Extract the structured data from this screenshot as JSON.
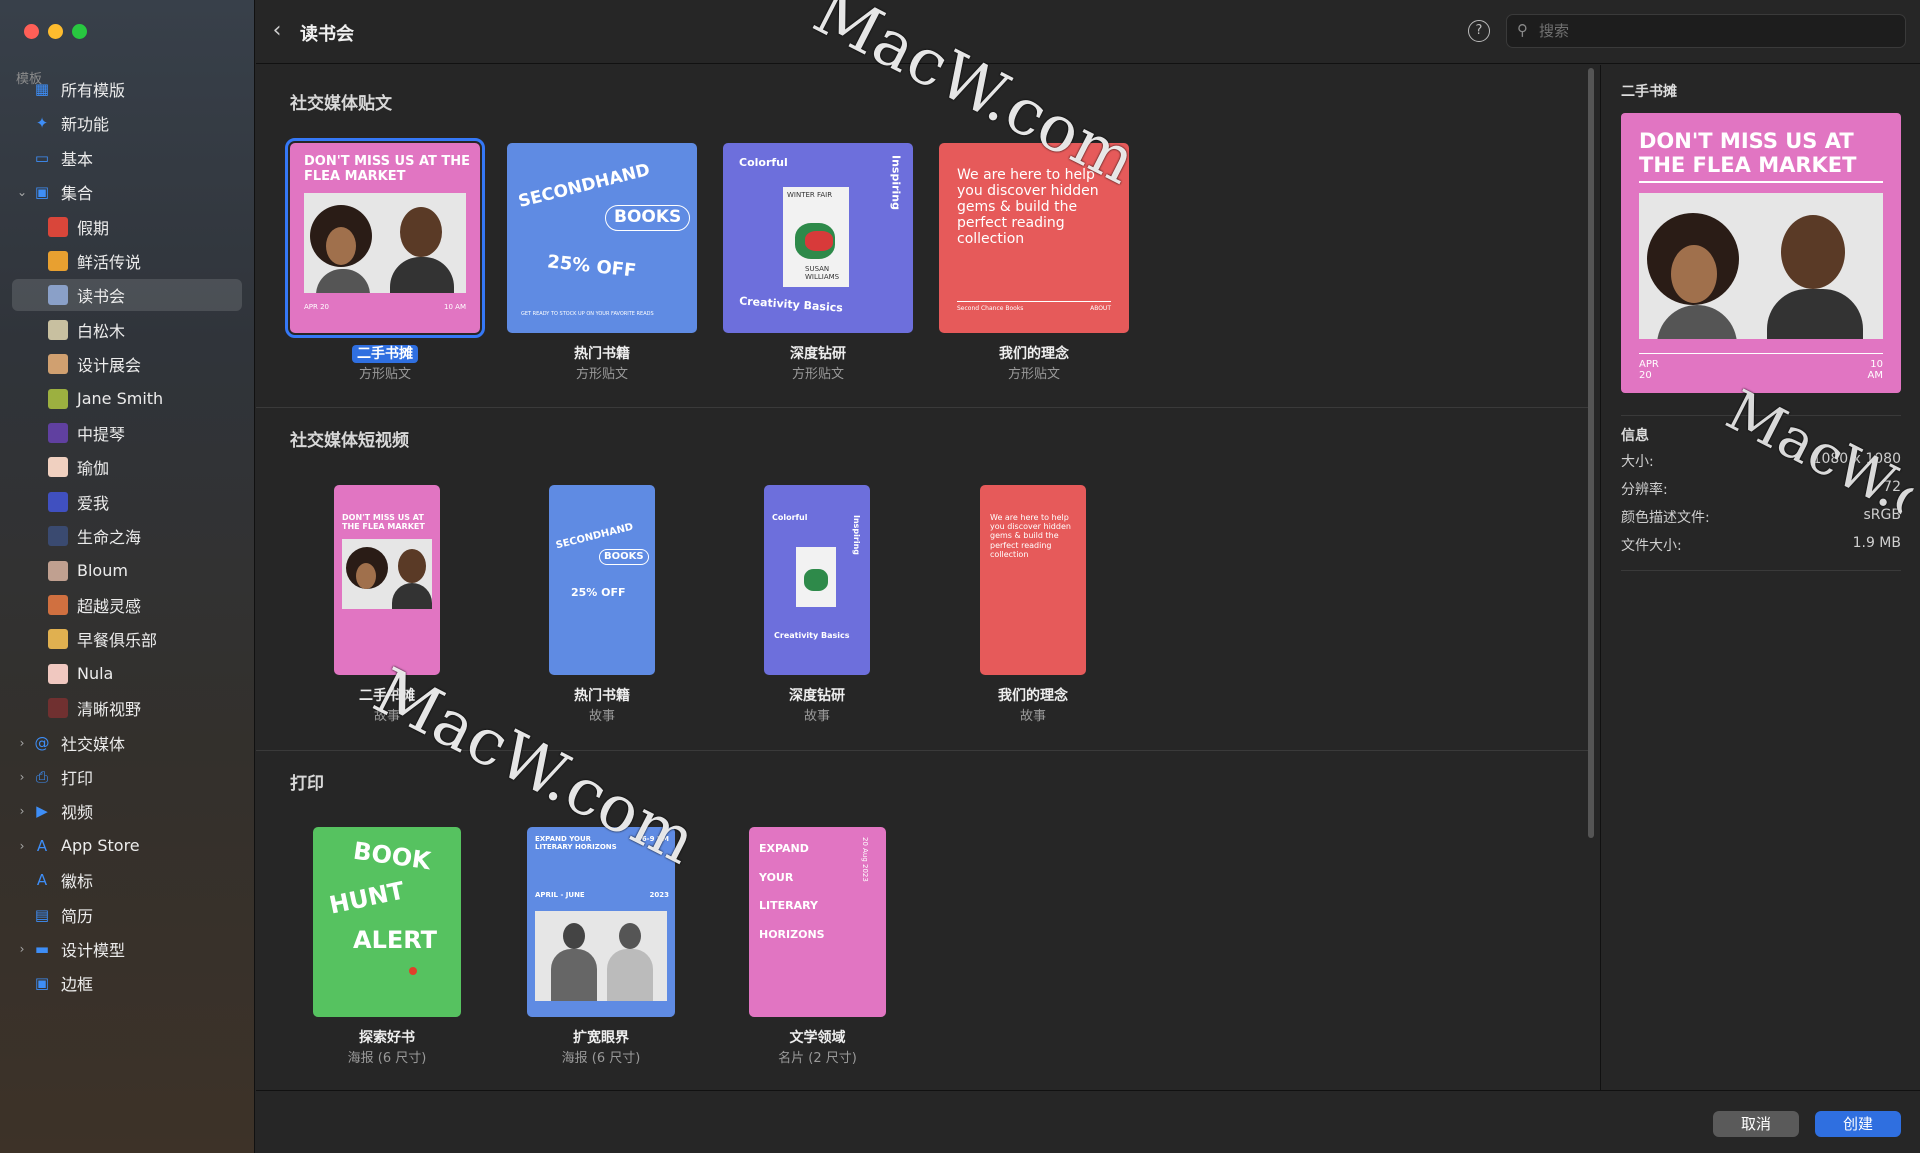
{
  "window": {
    "title": "读书会"
  },
  "sidebar": {
    "header": "模板",
    "items": [
      {
        "label": "所有模版",
        "icon": "grid-icon"
      },
      {
        "label": "新功能",
        "icon": "sparkle-icon"
      },
      {
        "label": "基本",
        "icon": "rectangle-icon"
      },
      {
        "label": "集合",
        "icon": "collection-icon"
      },
      {
        "label": "假期"
      },
      {
        "label": "鲜活传说"
      },
      {
        "label": "读书会"
      },
      {
        "label": "白松木"
      },
      {
        "label": "设计展会"
      },
      {
        "label": "Jane Smith"
      },
      {
        "label": "中提琴"
      },
      {
        "label": "瑜伽"
      },
      {
        "label": "爱我"
      },
      {
        "label": "生命之海"
      },
      {
        "label": "Bloum"
      },
      {
        "label": "超越灵感"
      },
      {
        "label": "早餐俱乐部"
      },
      {
        "label": "Nula"
      },
      {
        "label": "清晰视野"
      },
      {
        "label": "社交媒体",
        "icon": "at-icon"
      },
      {
        "label": "打印",
        "icon": "printer-icon"
      },
      {
        "label": "视频",
        "icon": "video-icon"
      },
      {
        "label": "App Store",
        "icon": "appstore-icon"
      },
      {
        "label": "徽标",
        "icon": "letter-a-icon"
      },
      {
        "label": "简历",
        "icon": "document-icon"
      },
      {
        "label": "设计模型",
        "icon": "monitor-icon"
      },
      {
        "label": "边框",
        "icon": "frame-icon"
      }
    ]
  },
  "search": {
    "placeholder": "搜索"
  },
  "sections": [
    {
      "title": "社交媒体贴文",
      "cards": [
        {
          "name": "二手书摊",
          "type": "方形贴文",
          "art": {
            "title": "DON'T MISS US AT THE FLEA MARKET",
            "date": "APR 20",
            "time": "10 AM"
          }
        },
        {
          "name": "热门书籍",
          "type": "方形贴文",
          "art": {
            "line1": "SECONDHAND",
            "line2": "BOOKS",
            "line3": "25% OFF",
            "foot": "GET READY TO STOCK UP ON YOUR FAVORITE READS"
          }
        },
        {
          "name": "深度钻研",
          "type": "方形贴文",
          "art": {
            "top": "Colorful",
            "side": "Inspiring",
            "book": "WINTER FAIR",
            "author": "SUSAN WILLIAMS",
            "bottom": "Creativity Basics"
          }
        },
        {
          "name": "我们的理念",
          "type": "方形贴文",
          "art": {
            "text": "We are here to help you discover hidden gems & build the perfect reading collection",
            "left": "Second Chance Books",
            "right": "ABOUT"
          }
        }
      ]
    },
    {
      "title": "社交媒体短视频",
      "cards": [
        {
          "name": "二手书摊",
          "type": "故事"
        },
        {
          "name": "热门书籍",
          "type": "故事"
        },
        {
          "name": "深度钻研",
          "type": "故事"
        },
        {
          "name": "我们的理念",
          "type": "故事"
        }
      ]
    },
    {
      "title": "打印",
      "cards": [
        {
          "name": "探索好书",
          "type": "海报 (6 尺寸)",
          "art": {
            "l1": "BOOK",
            "l2": "HUNT",
            "l3": "ALERT"
          }
        },
        {
          "name": "扩宽眼界",
          "type": "海报 (6 尺寸)",
          "art": {
            "title": "EXPAND YOUR LITERARY HORIZONS",
            "time": "6-9 PM",
            "dates": "APRIL - JUNE",
            "year": "2023"
          }
        },
        {
          "name": "文学领域",
          "type": "名片 (2 尺寸)",
          "art": {
            "title": "EXPAND YOUR LITERARY HORIZONS",
            "side": "20 Aug 2023"
          }
        }
      ]
    }
  ],
  "info": {
    "name": "二手书摊",
    "header": "信息",
    "rows": [
      {
        "k": "大小:",
        "v": "1080 x 1080"
      },
      {
        "k": "分辨率:",
        "v": "72"
      },
      {
        "k": "颜色描述文件:",
        "v": "sRGB"
      },
      {
        "k": "文件大小:",
        "v": "1.9 MB"
      }
    ]
  },
  "footer": {
    "cancel": "取消",
    "create": "创建"
  },
  "watermark": "MacW.com",
  "colors": {
    "accent": "#3578f6",
    "pink": "#e175c2",
    "blue": "#5f8be3",
    "purple": "#6d6fdc",
    "red": "#e65a5a",
    "green": "#56c260"
  }
}
